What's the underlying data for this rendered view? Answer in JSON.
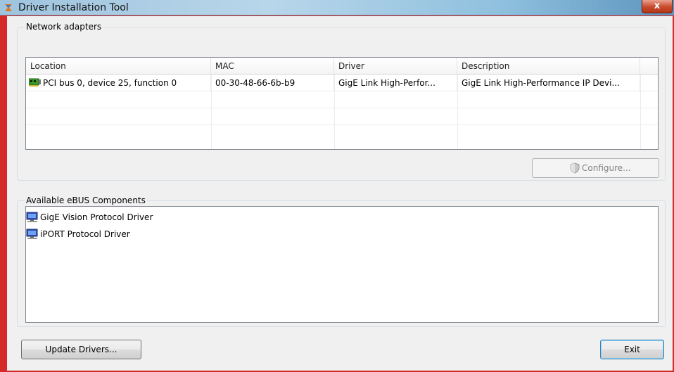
{
  "window": {
    "title": "Driver Installation Tool",
    "close_label": "x"
  },
  "network_adapters": {
    "label": "Network adapters",
    "columns": [
      "Location",
      "MAC",
      "Driver",
      "Description"
    ],
    "rows": [
      {
        "location": "PCI bus 0, device 25, function 0",
        "mac": "00-30-48-66-6b-b9",
        "driver": "GigE Link High-Perfor...",
        "description": "GigE Link High-Performance IP Devi..."
      }
    ],
    "configure_label": "Configure..."
  },
  "components": {
    "label": "Available eBUS Components",
    "items": [
      {
        "label": "GigE Vision Protocol Driver",
        "icon": "computer-icon"
      },
      {
        "label": "iPORT Protocol Driver",
        "icon": "computer-icon"
      }
    ]
  },
  "footer": {
    "update_label": "Update Drivers...",
    "exit_label": "Exit"
  },
  "colors": {
    "frame": "#d42a2a",
    "titlebar": "#9fc4de",
    "close": "#c84a2c"
  }
}
